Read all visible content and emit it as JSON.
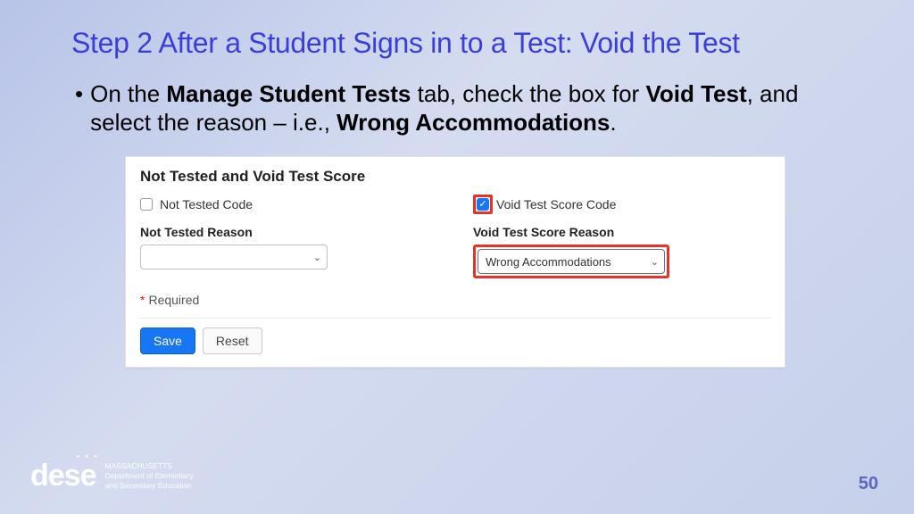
{
  "title": "Step 2 After a Student Signs in to a Test: Void the Test",
  "bullet": {
    "p1": "On the ",
    "b1": "Manage Student Tests",
    "p2": " tab, check the box for ",
    "b2": "Void Test",
    "p3": ", and select the reason – i.e., ",
    "b3": "Wrong Accommodations",
    "p4": "."
  },
  "panel": {
    "heading": "Not Tested and Void Test Score",
    "not_tested_chk_label": "Not Tested Code",
    "void_chk_label": "Void Test Score Code",
    "not_tested_reason_label": "Not Tested Reason",
    "void_reason_label": "Void Test Score Reason",
    "not_tested_reason_value": "",
    "void_reason_value": "Wrong Accommodations",
    "required_text": "Required",
    "save_label": "Save",
    "reset_label": "Reset"
  },
  "logo": {
    "mark": "dese",
    "line1": "MASSACHUSETTS",
    "line2": "Department of Elementary",
    "line3": "and Secondary Education"
  },
  "page_number": "50"
}
